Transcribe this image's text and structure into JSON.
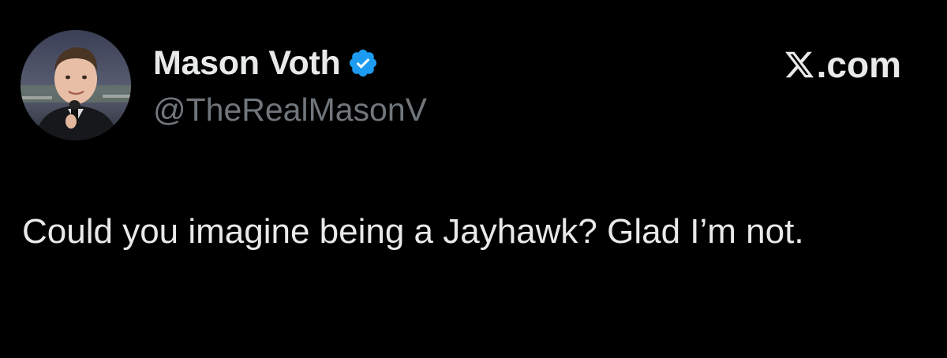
{
  "author": {
    "display_name": "Mason Voth",
    "handle": "@TheRealMasonV",
    "verified": true,
    "avatar_icon": "profile-photo",
    "verified_icon": "verified-badge-icon"
  },
  "brand": {
    "logo_icon": "x-logo-icon",
    "text": ".com"
  },
  "tweet": {
    "text": "Could you imagine being a Jayhawk? Glad I’m not."
  },
  "colors": {
    "background": "#000000",
    "primary_text": "#e7e9ea",
    "secondary_text": "#71767b",
    "verified_blue": "#1d9bf0"
  }
}
